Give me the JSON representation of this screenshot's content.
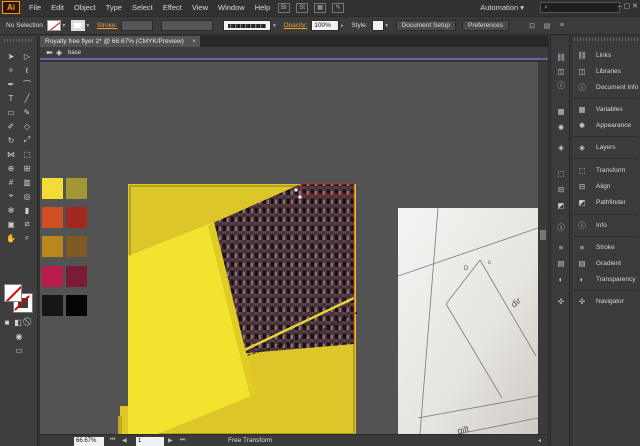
{
  "app": {
    "logo": "Ai"
  },
  "menubar": {
    "items": [
      "File",
      "Edit",
      "Object",
      "Type",
      "Select",
      "Effect",
      "View",
      "Window",
      "Help"
    ],
    "bridge_label": "Br",
    "stock_label": "St",
    "workspace": "Automation",
    "workspace_caret": "▾"
  },
  "control_bar": {
    "selection": "No Selection",
    "stroke_label": "Stroke:",
    "opacity_label": "Opacity:",
    "opacity_value": "100%",
    "style_label": "Style:",
    "document_setup": "Document Setup",
    "preferences": "Preferences"
  },
  "document": {
    "tab_title": "Royalty free flyer 2* @ 66.67% (CMYK/Preview)",
    "tab_close": "×",
    "layer_name": "base"
  },
  "status_bar": {
    "zoom": "66.67%",
    "page": "1",
    "status_text": "Free Transform"
  },
  "swatches": [
    "#f2dc35",
    "#a39634",
    "#d04f24",
    "#a0281f",
    "#b8881e",
    "#7e5a23",
    "#b81d4c",
    "#7a1c38",
    "#161616",
    "#050505"
  ],
  "right_panel": {
    "items": [
      "Links",
      "Libraries",
      "Document Info",
      "Variables",
      "Appearance",
      "Layers",
      "Transform",
      "Align",
      "Pathfinder",
      "Info",
      "Stroke",
      "Gradient",
      "Transparency",
      "Navigator"
    ]
  },
  "colors": {
    "accent": "#ff9a00",
    "artboard_yellow": "#dcc62a",
    "bright_yellow": "#f2e32e",
    "selection_red": "#d03030",
    "layer_blue": "#5e6aa8"
  }
}
